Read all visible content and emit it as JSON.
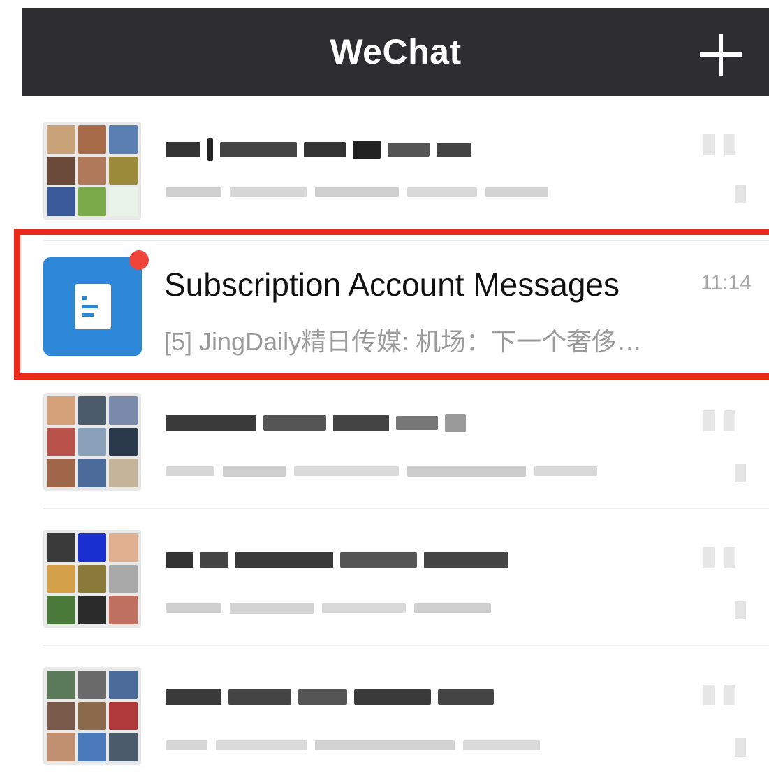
{
  "app": {
    "title": "WeChat",
    "add_icon": "plus-icon"
  },
  "conversations": [
    {
      "type": "group",
      "avatar_colors": [
        "#c9a27a",
        "#a86b4a",
        "#5a7fb0",
        "#6b4a3a",
        "#b07a5a",
        "#9a8a3a",
        "#3a5a9a",
        "#7aaa4a",
        "#eaf3ea"
      ]
    },
    {
      "type": "subscription",
      "name": "Subscription Account Messages",
      "time": "11:14",
      "preview": "[5] JingDaily精日传媒: 机场：下一个奢侈…",
      "unread_dot": true,
      "icon": "document-icon",
      "icon_color": "#2d86d6",
      "highlight_color": "#e8291c"
    },
    {
      "type": "group",
      "avatar_colors": [
        "#d4a07a",
        "#4a5a6a",
        "#7a8aaa",
        "#b8524a",
        "#8aa0b8",
        "#2a3a4a",
        "#a0664a",
        "#4a6a9a",
        "#c4b49a"
      ]
    },
    {
      "type": "group",
      "avatar_colors": [
        "#3a3a3a",
        "#1a2fd0",
        "#e0b090",
        "#d4a04a",
        "#8a7a3a",
        "#a8a8a8",
        "#4a7a3a",
        "#2a2a2a",
        "#c07060"
      ]
    },
    {
      "type": "group",
      "avatar_colors": [
        "#5a7a5a",
        "#6a6a6a",
        "#4a6a9a",
        "#7a5a4a",
        "#8a6a4a",
        "#b03a3a",
        "#c09070",
        "#4a7aba",
        "#4a5a6a"
      ]
    }
  ]
}
